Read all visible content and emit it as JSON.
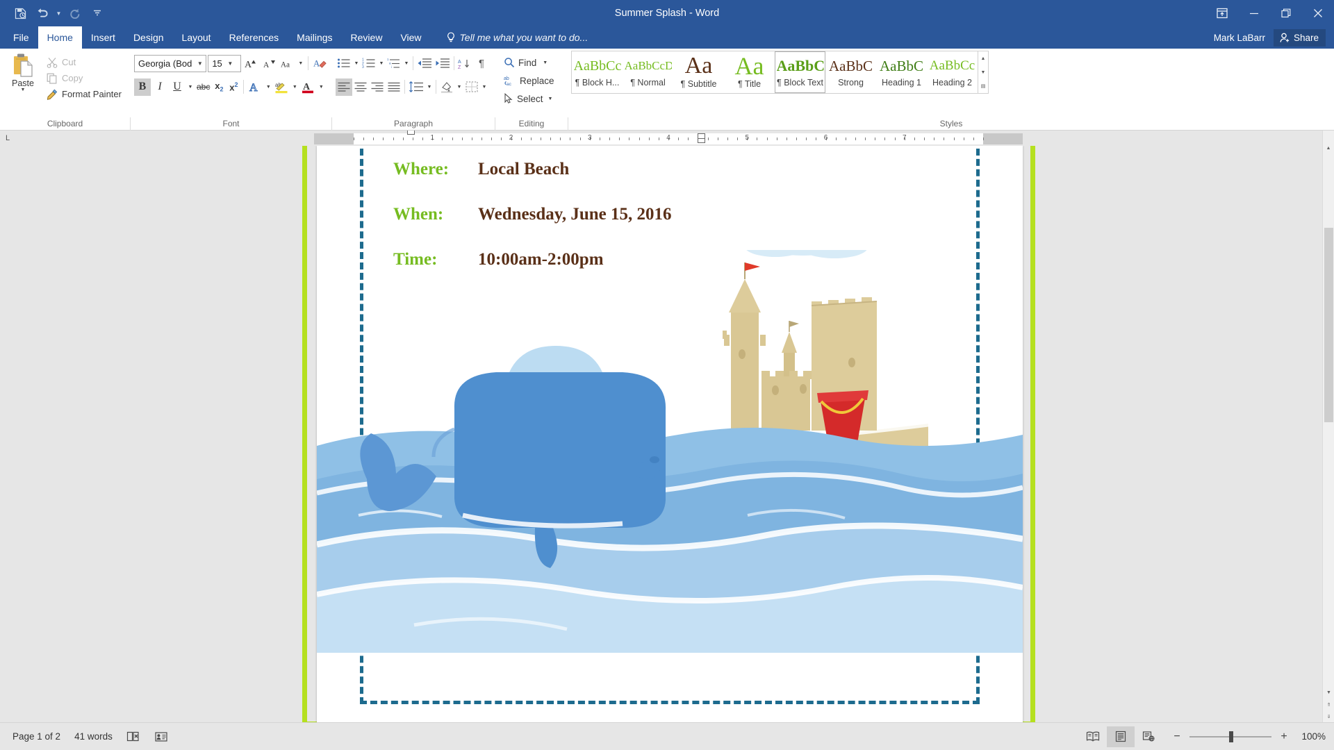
{
  "titlebar": {
    "document_title": "Summer Splash - Word",
    "quick_access": [
      {
        "name": "save-icon",
        "label": "Save"
      },
      {
        "name": "undo-icon",
        "label": "Undo"
      },
      {
        "name": "redo-icon",
        "label": "Redo"
      },
      {
        "name": "customize-quick-access-icon",
        "label": "Customize Quick Access Toolbar"
      }
    ],
    "window_controls": [
      {
        "name": "ribbon-display-options-icon",
        "label": "Ribbon Display Options"
      },
      {
        "name": "minimize-icon",
        "label": "Minimize"
      },
      {
        "name": "restore-icon",
        "label": "Restore Down"
      },
      {
        "name": "close-icon",
        "label": "Close"
      }
    ]
  },
  "tabs": [
    {
      "label": "File",
      "active": false
    },
    {
      "label": "Home",
      "active": true
    },
    {
      "label": "Insert",
      "active": false
    },
    {
      "label": "Design",
      "active": false
    },
    {
      "label": "Layout",
      "active": false
    },
    {
      "label": "References",
      "active": false
    },
    {
      "label": "Mailings",
      "active": false
    },
    {
      "label": "Review",
      "active": false
    },
    {
      "label": "View",
      "active": false
    }
  ],
  "tell_me": {
    "placeholder": "Tell me what you want to do..."
  },
  "account": {
    "user_name": "Mark LaBarr",
    "share_label": "Share"
  },
  "ribbon": {
    "groups": [
      {
        "label": "Clipboard"
      },
      {
        "label": "Font"
      },
      {
        "label": "Paragraph"
      },
      {
        "label": "Editing"
      },
      {
        "label": "Styles"
      }
    ],
    "clipboard": {
      "paste_label": "Paste",
      "cut_label": "Cut",
      "copy_label": "Copy",
      "format_painter_label": "Format Painter"
    },
    "font": {
      "font_name": "Georgia (Bod",
      "font_size": "15",
      "grow_font_label": "Grow Font",
      "shrink_font_label": "Shrink Font",
      "change_case_label": "Change Case",
      "clear_formatting_label": "Clear All Formatting",
      "bold_label": "B",
      "italic_label": "I",
      "underline_label": "U",
      "strikethrough_label": "abc",
      "subscript_label": "x",
      "superscript_label": "x",
      "text_effects_label": "Text Effects and Typography",
      "highlight_label": "Text Highlight Color",
      "font_color_label": "Font Color",
      "bold_active": true
    },
    "paragraph": {
      "bullets_label": "Bullets",
      "numbering_label": "Numbering",
      "multilevel_label": "Multilevel List",
      "decrease_indent_label": "Decrease Indent",
      "increase_indent_label": "Increase Indent",
      "sort_label": "Sort",
      "show_marks_label": "Show/Hide Paragraph Marks",
      "align_left_label": "Align Left",
      "center_label": "Center",
      "align_right_label": "Align Right",
      "justify_label": "Justify",
      "line_spacing_label": "Line and Paragraph Spacing",
      "shading_label": "Shading",
      "borders_label": "Borders",
      "align_left_active": true
    },
    "editing": {
      "find_label": "Find",
      "replace_label": "Replace",
      "select_label": "Select"
    },
    "styles": {
      "items": [
        {
          "preview": "AaBbCc",
          "name": "¶ Block H...",
          "color": "#76bc21",
          "size": "20px",
          "weight": "normal",
          "selected": false
        },
        {
          "preview": "AaBbCcD",
          "name": "¶ Normal",
          "color": "#76bc21",
          "size": "17px",
          "weight": "normal",
          "selected": false
        },
        {
          "preview": "Aa",
          "name": "¶ Subtitle",
          "color": "#5a3018",
          "size": "34px",
          "weight": "normal",
          "selected": false
        },
        {
          "preview": "Aa",
          "name": "¶ Title",
          "color": "#76bc21",
          "size": "34px",
          "weight": "normal",
          "selected": false
        },
        {
          "preview": "AaBbC",
          "name": "¶ Block Text",
          "color": "#5a9e18",
          "size": "22px",
          "weight": "bold",
          "selected": true
        },
        {
          "preview": "AaBbC",
          "name": "Strong",
          "color": "#5a3018",
          "size": "21px",
          "weight": "normal",
          "selected": false
        },
        {
          "preview": "AaBbC",
          "name": "Heading 1",
          "color": "#3f7d16",
          "size": "21px",
          "weight": "normal",
          "selected": false
        },
        {
          "preview": "AaBbCc",
          "name": "Heading 2",
          "color": "#76bc21",
          "size": "19px",
          "weight": "normal",
          "selected": false
        }
      ]
    }
  },
  "ruler": {
    "labels": [
      "1",
      "2",
      "3",
      "4",
      "5",
      "6",
      "7"
    ]
  },
  "document": {
    "rows": [
      {
        "label": "Where:",
        "value": "Local Beach"
      },
      {
        "label": "When:",
        "value": "Wednesday, June 15, 2016"
      },
      {
        "label": "Time:",
        "value": "10:00am-2:00pm"
      }
    ],
    "selection_border_color": "#b5e01f",
    "dashed_border_color": "#1d6b8e",
    "label_color": "#76bc21",
    "value_color": "#5a3018"
  },
  "illustration": {
    "sea_colors": [
      "#4f8fcf",
      "#7fb4e0",
      "#a7cdec",
      "#c5e0f4"
    ],
    "whale_color": "#4f8fcf",
    "sand_color": "#ddcc9b",
    "cloud_color": "#d7ebf7",
    "bucket_color": "#d42a2a",
    "flag_color": "#e03a2a"
  },
  "statusbar": {
    "page_info": "Page 1 of 2",
    "word_count": "41 words",
    "proofing_icon": "proofing-errors-icon",
    "accessibility_icon": "accessibility-checker-icon",
    "views": [
      {
        "name": "read-mode-view-button",
        "label": "Read Mode",
        "active": false
      },
      {
        "name": "print-layout-view-button",
        "label": "Print Layout",
        "active": true
      },
      {
        "name": "web-layout-view-button",
        "label": "Web Layout",
        "active": false
      }
    ],
    "zoom_out_label": "−",
    "zoom_in_label": "+",
    "zoom_level": "100%"
  }
}
